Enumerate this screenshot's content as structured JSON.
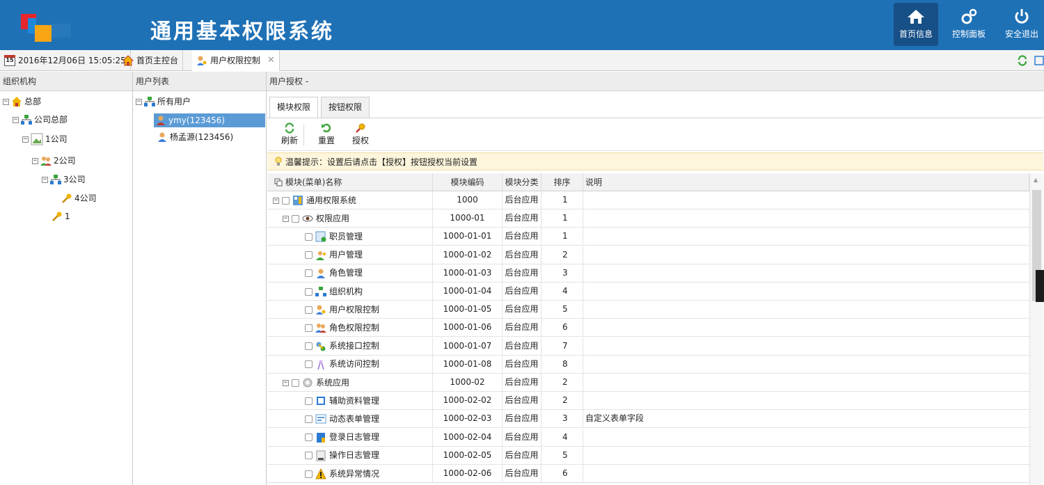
{
  "header": {
    "title": "通用基本权限系统",
    "buttons": [
      {
        "label": "首页信息",
        "icon": "home-icon"
      },
      {
        "label": "控制面板",
        "icon": "gears-icon"
      },
      {
        "label": "安全退出",
        "icon": "power-icon"
      }
    ],
    "colors": {
      "bar": "#1f71b6",
      "active": "#174f87"
    }
  },
  "tabbar": {
    "datetime": "2016年12月06日 15:05:25",
    "calendar_day": "15",
    "tabs": [
      {
        "label": "首页主控台",
        "icon": "home-icon"
      },
      {
        "label": "用户权限控制",
        "icon": "user-key-icon",
        "closable": true
      }
    ]
  },
  "org_panel": {
    "title": "组织机构",
    "nodes": [
      "总部",
      "公司总部",
      "1公司",
      "2公司",
      "3公司",
      "4公司",
      "1"
    ]
  },
  "user_panel": {
    "title": "用户列表",
    "root": "所有用户",
    "users": [
      "ymy(123456)",
      "杨孟源(123456)"
    ]
  },
  "auth_panel": {
    "title": "用户授权 -",
    "tabs": [
      "模块权限",
      "按钮权限"
    ],
    "toolbar": {
      "refresh": "刷新",
      "reset": "重置",
      "authorize": "授权"
    },
    "tip": "温馨提示：设置后请点击【授权】按钮授权当前设置",
    "columns": [
      "模块(菜单)名称",
      "模块编码",
      "模块分类",
      "排序",
      "说明"
    ],
    "rows": [
      {
        "name": "通用权限系统",
        "code": "1000",
        "category": "后台应用",
        "order": "1",
        "desc": ""
      },
      {
        "name": "权限应用",
        "code": "1000-01",
        "category": "后台应用",
        "order": "1",
        "desc": ""
      },
      {
        "name": "职员管理",
        "code": "1000-01-01",
        "category": "后台应用",
        "order": "1",
        "desc": ""
      },
      {
        "name": "用户管理",
        "code": "1000-01-02",
        "category": "后台应用",
        "order": "2",
        "desc": ""
      },
      {
        "name": "角色管理",
        "code": "1000-01-03",
        "category": "后台应用",
        "order": "3",
        "desc": ""
      },
      {
        "name": "组织机构",
        "code": "1000-01-04",
        "category": "后台应用",
        "order": "4",
        "desc": ""
      },
      {
        "name": "用户权限控制",
        "code": "1000-01-05",
        "category": "后台应用",
        "order": "5",
        "desc": ""
      },
      {
        "name": "角色权限控制",
        "code": "1000-01-06",
        "category": "后台应用",
        "order": "6",
        "desc": ""
      },
      {
        "name": "系统接口控制",
        "code": "1000-01-07",
        "category": "后台应用",
        "order": "7",
        "desc": ""
      },
      {
        "name": "系统访问控制",
        "code": "1000-01-08",
        "category": "后台应用",
        "order": "8",
        "desc": ""
      },
      {
        "name": "系统应用",
        "code": "1000-02",
        "category": "后台应用",
        "order": "2",
        "desc": ""
      },
      {
        "name": "辅助资料管理",
        "code": "1000-02-02",
        "category": "后台应用",
        "order": "2",
        "desc": ""
      },
      {
        "name": "动态表单管理",
        "code": "1000-02-03",
        "category": "后台应用",
        "order": "3",
        "desc": "自定义表单字段"
      },
      {
        "name": "登录日志管理",
        "code": "1000-02-04",
        "category": "后台应用",
        "order": "4",
        "desc": ""
      },
      {
        "name": "操作日志管理",
        "code": "1000-02-05",
        "category": "后台应用",
        "order": "5",
        "desc": ""
      },
      {
        "name": "系统异常情况",
        "code": "1000-02-06",
        "category": "后台应用",
        "order": "6",
        "desc": ""
      }
    ]
  }
}
